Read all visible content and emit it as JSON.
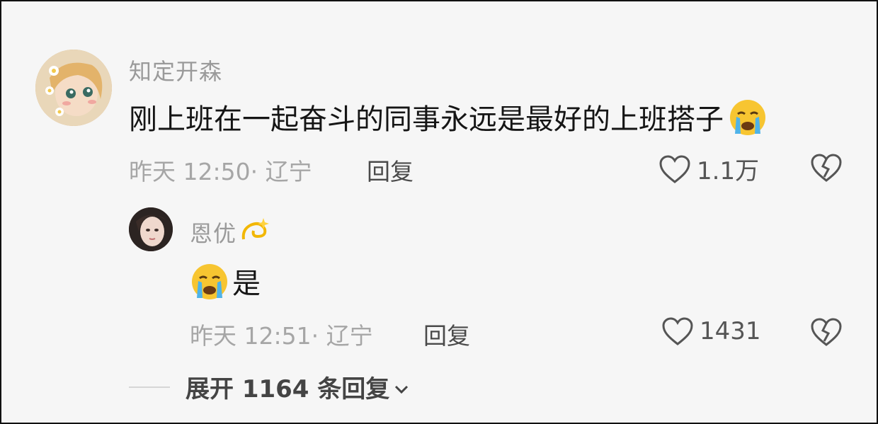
{
  "comment": {
    "username": "知定开森",
    "text": "刚上班在一起奋斗的同事永远是最好的上班搭子",
    "emoji": "loudly-crying-face",
    "time_location": "昨天 12:50· 辽宁",
    "reply_label": "回复",
    "like_count": "1.1万"
  },
  "reply": {
    "username": "恩优",
    "username_emoji": "dizzy-symbol",
    "emoji": "loudly-crying-face",
    "text": "是",
    "time_location": "昨天 12:51· 辽宁",
    "reply_label": "回复",
    "like_count": "1431"
  },
  "expand": {
    "label": "展开 1164 条回复"
  },
  "colors": {
    "name_gray": "#9a9a9a",
    "meta_gray": "#a6a6a6",
    "body_text": "#151515",
    "background": "#f6f6f6"
  }
}
